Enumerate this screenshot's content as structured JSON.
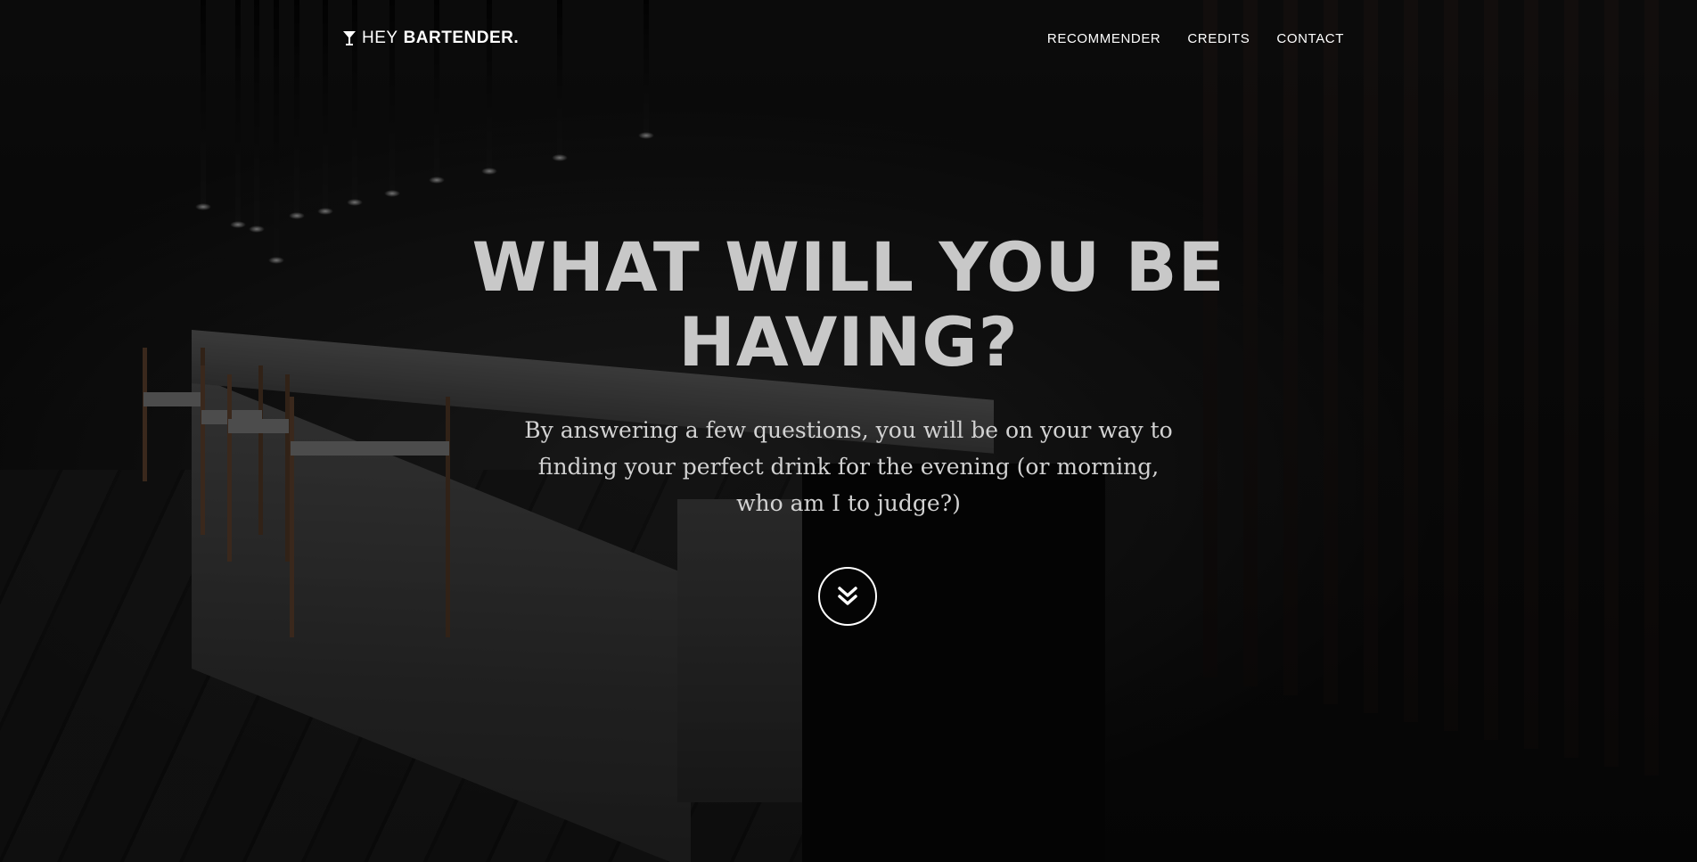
{
  "brand": {
    "prefix": "HEY",
    "name": "BARTENDER.",
    "icon": "cocktail-glass-icon"
  },
  "nav": {
    "items": [
      {
        "label": "RECOMMENDER"
      },
      {
        "label": "CREDITS"
      },
      {
        "label": "CONTACT"
      }
    ]
  },
  "hero": {
    "headline": "WHAT WILL YOU BE HAVING?",
    "subtitle": "By answering a few questions, you will be on your way to finding your perfect drink for the evening (or morning, who am I to judge?)",
    "scroll_icon": "double-chevron-down-icon"
  },
  "colors": {
    "text": "#ffffff",
    "headline": "#c8c8c8",
    "background": "#0b0b0b"
  }
}
